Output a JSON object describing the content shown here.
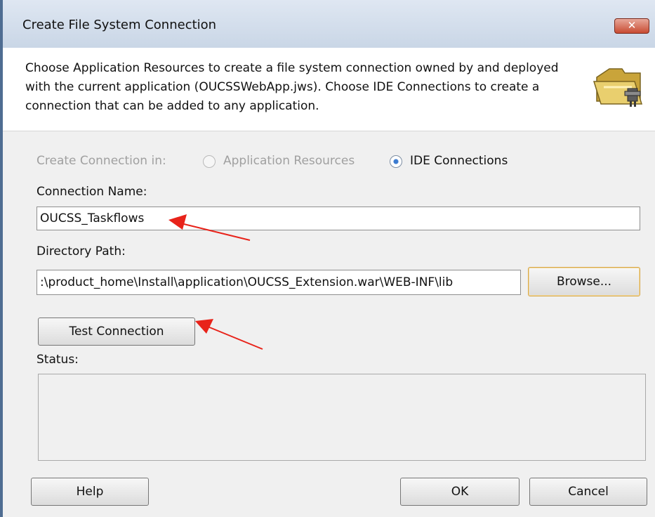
{
  "window": {
    "title": "Create File System Connection",
    "close_glyph": "✕"
  },
  "header": {
    "description": "Choose Application Resources to create a file system connection owned by and deployed with the current application (OUCSSWebApp.jws). Choose IDE Connections to create a connection that can be added to any application.",
    "icon": "folder-connection-icon"
  },
  "form": {
    "create_in_label": "Create Connection in:",
    "options": [
      {
        "label": "Application Resources",
        "selected": false,
        "enabled": false
      },
      {
        "label": "IDE Connections",
        "selected": true,
        "enabled": true
      }
    ],
    "connection_name_label": "Connection Name:",
    "connection_name_value": "OUCSS_Taskflows",
    "directory_path_label": "Directory Path:",
    "directory_path_value": ":\\product_home\\Install\\application\\OUCSS_Extension.war\\WEB-INF\\lib",
    "browse_label": "Browse...",
    "test_connection_label": "Test Connection",
    "status_label": "Status:",
    "status_value": ""
  },
  "footer": {
    "help_label": "Help",
    "ok_label": "OK",
    "cancel_label": "Cancel"
  },
  "annotations": {
    "arrow_color": "#e8231a"
  }
}
